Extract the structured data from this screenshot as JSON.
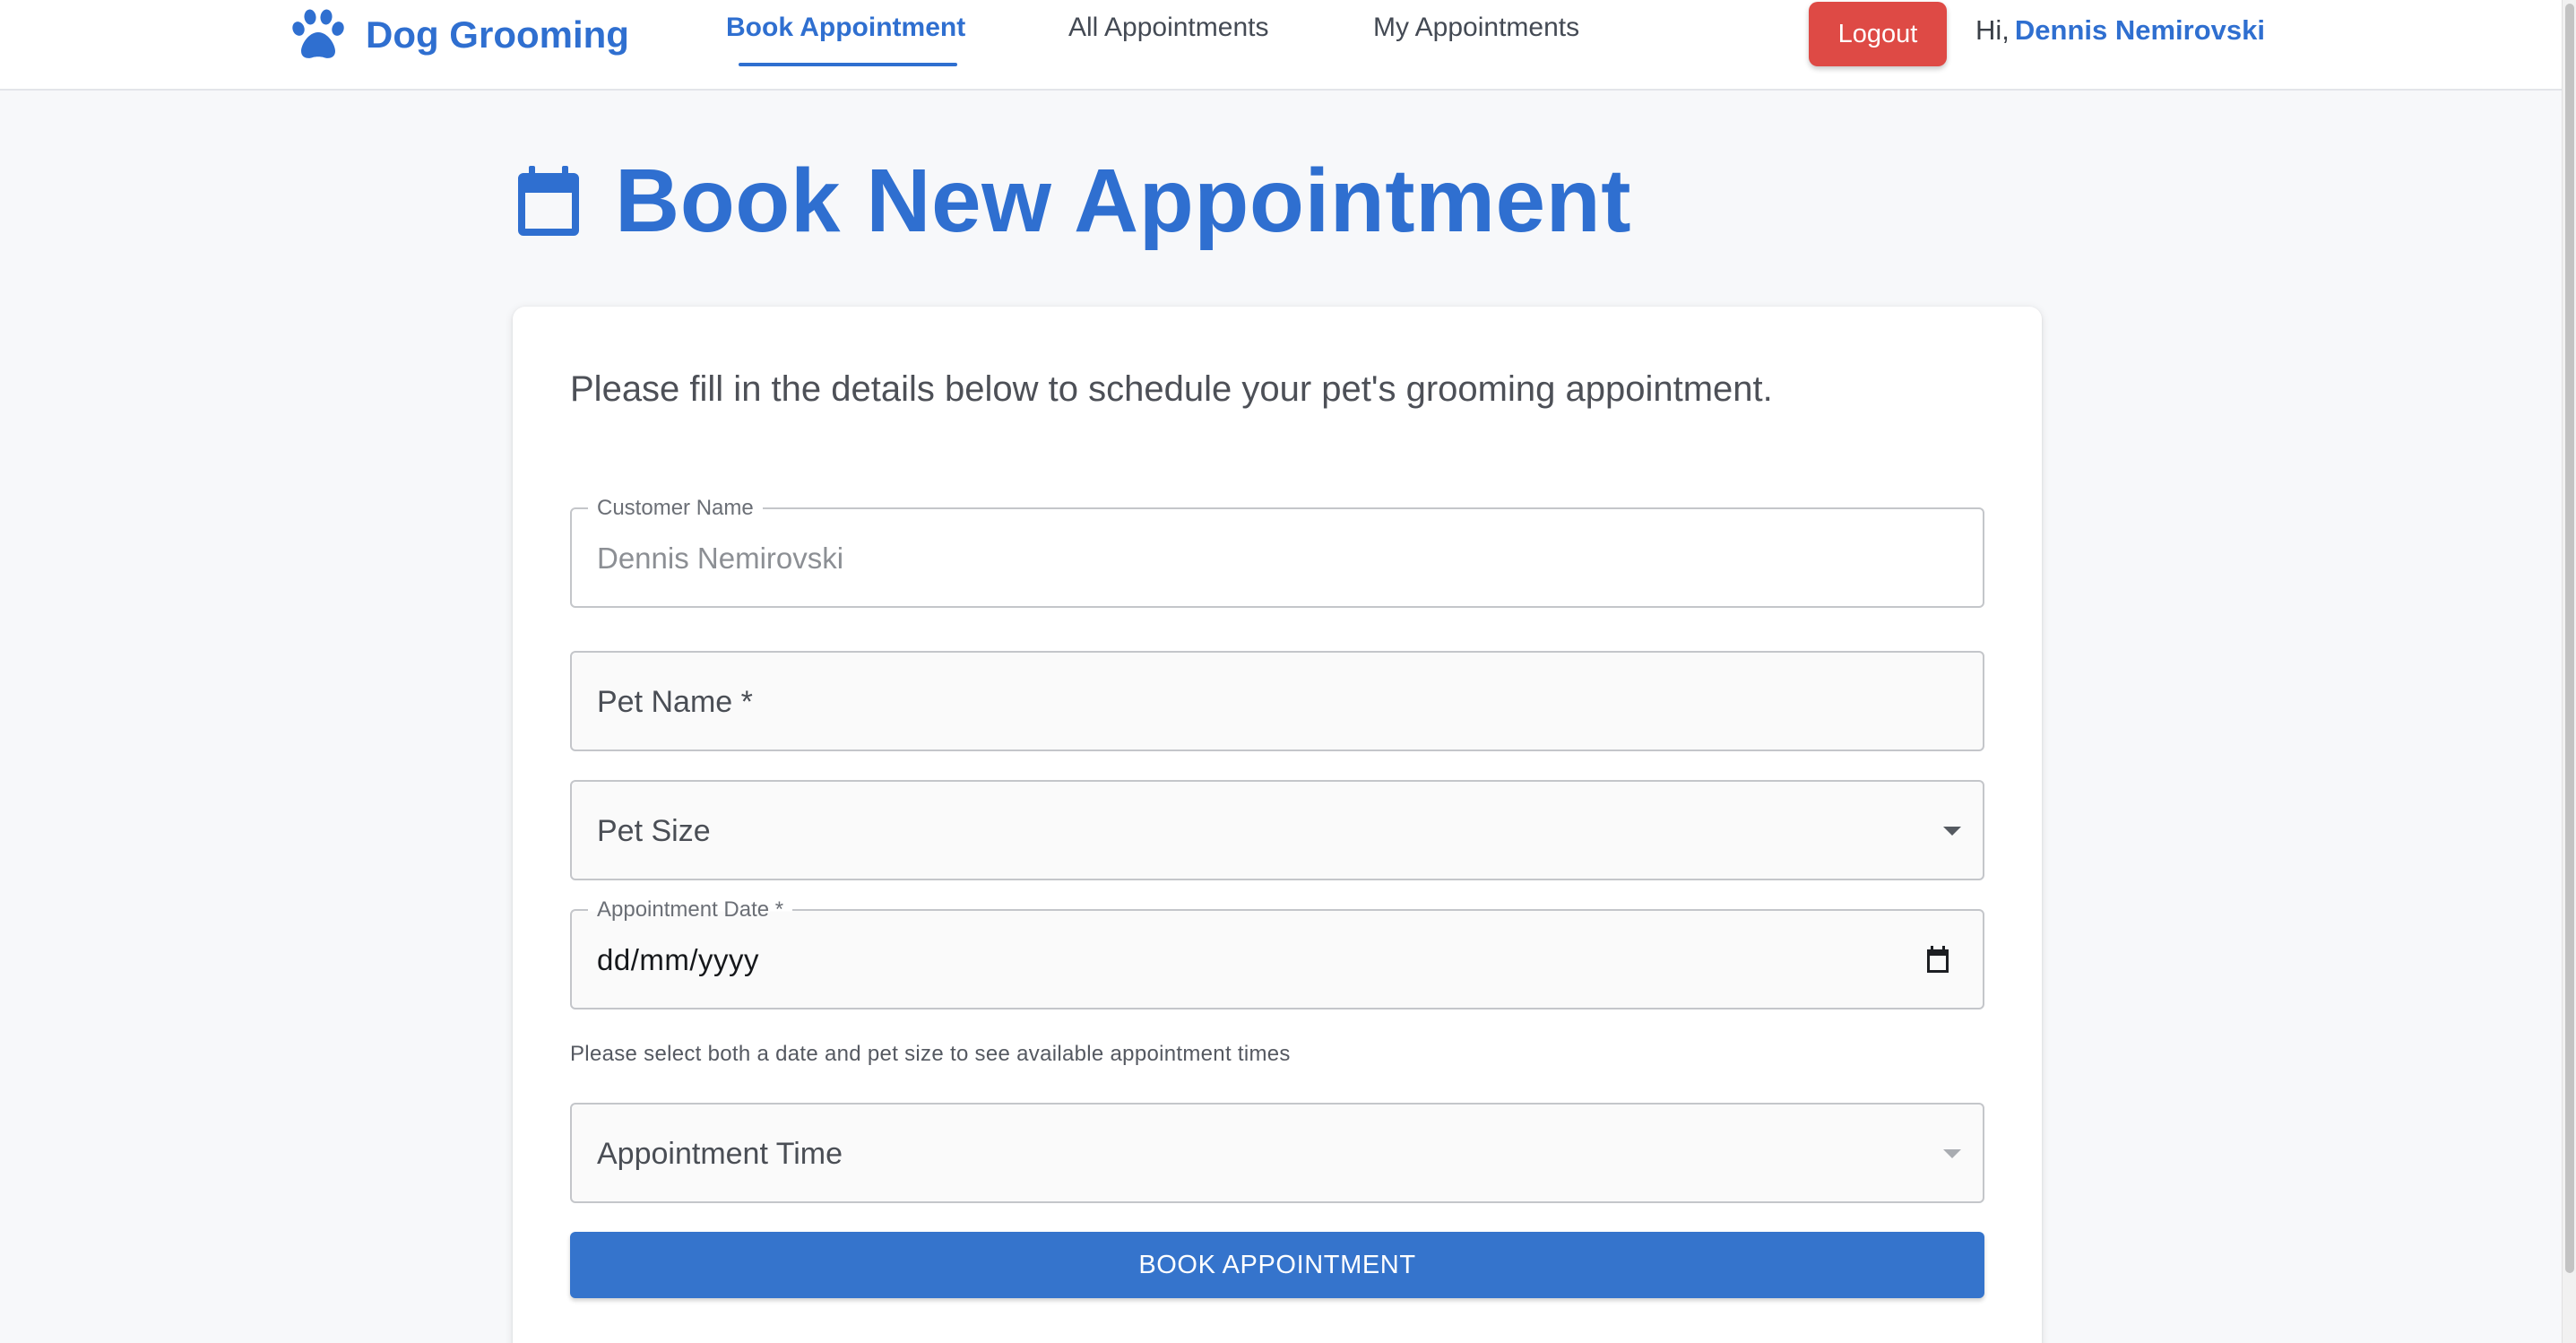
{
  "colors": {
    "brand_blue": "#2f6fd0",
    "logout_red": "#de4a45",
    "button_blue": "#3574cc",
    "page_background": "#f7f8fa"
  },
  "nav": {
    "brand_icon": "paw-icon",
    "brand_title": "Dog Grooming",
    "links": [
      {
        "label": "Book Appointment",
        "active": true
      },
      {
        "label": "All Appointments",
        "active": false
      },
      {
        "label": "My Appointments",
        "active": false
      }
    ],
    "logout_label": "Logout",
    "greeting_prefix": "Hi,",
    "user_name": "Dennis Nemirovski"
  },
  "heading": {
    "icon": "calendar-icon",
    "title": "Book New Appointment"
  },
  "form": {
    "intro": "Please fill in the details below to schedule your pet's grooming appointment.",
    "customer_name": {
      "label": "Customer Name",
      "value": "Dennis Nemirovski",
      "disabled": true
    },
    "pet_name": {
      "label": "Pet Name *",
      "value": ""
    },
    "pet_size": {
      "label": "Pet Size",
      "selected": "",
      "icon": "dropdown-caret-icon"
    },
    "appointment_date": {
      "label": "Appointment Date *",
      "value": "dd/mm/yyyy",
      "icon": "calendar-picker-icon"
    },
    "helper_text": "Please select both a date and pet size to see available appointment times",
    "appointment_time": {
      "label": "Appointment Time",
      "selected": "",
      "icon": "dropdown-caret-icon",
      "disabled": true
    },
    "submit_label": "BOOK APPOINTMENT"
  }
}
